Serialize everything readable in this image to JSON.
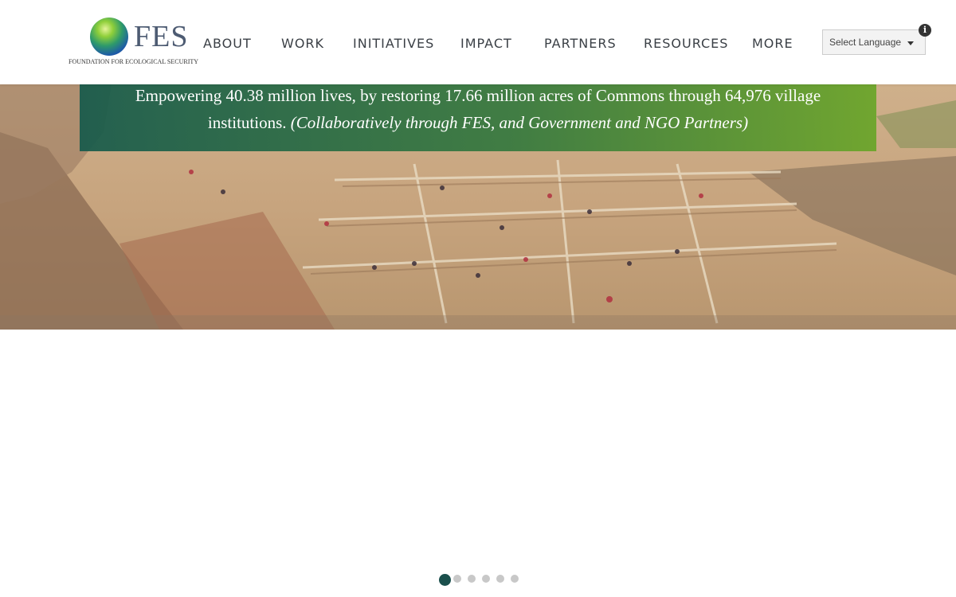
{
  "brand": {
    "name": "FES",
    "tagline": "FOUNDATION FOR ECOLOGICAL SECURITY"
  },
  "nav": {
    "items": [
      {
        "label": "ABOUT"
      },
      {
        "label": "WORK"
      },
      {
        "label": "INITIATIVES"
      },
      {
        "label": "IMPACT"
      },
      {
        "label": "PARTNERS"
      },
      {
        "label": "RESOURCES"
      },
      {
        "label": "MORE"
      }
    ]
  },
  "language": {
    "label": "Select Language",
    "info_icon": "info-icon",
    "caret_icon": "chevron-down-icon"
  },
  "banner": {
    "line1": "Empowering 40.38 million lives, by restoring 17.66 million acres of Commons through 64,976 village",
    "line2_plain": "institutions.",
    "line2_italic": "(Collaboratively through FES, and Government and NGO Partners)"
  },
  "carousel": {
    "slide_count": 6,
    "active_index": 0
  },
  "colors": {
    "brand_teal": "#1a4f4c",
    "banner_green_start": "#165a4b",
    "banner_green_end": "#69a528",
    "nav_text": "#3a3f45"
  }
}
